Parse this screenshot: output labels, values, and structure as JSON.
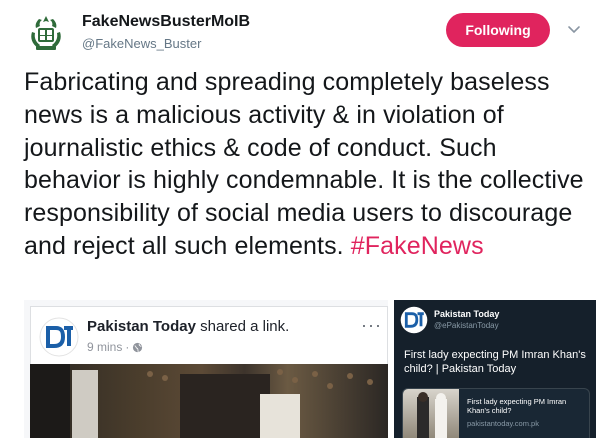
{
  "profile": {
    "name": "FakeNewsBusterMoIB",
    "handle": "@FakeNews_Buster"
  },
  "follow_button_label": "Following",
  "tweet": {
    "text": "Fabricating and spreading completely baseless news is a malicious activity & in violation of journalistic ethics & code of conduct. Such behavior is highly condemnable. It is the collective responsibility of social media users to discourage and reject all such elements. ",
    "hashtag": "#FakeNews"
  },
  "facebook_post": {
    "page_name": "Pakistan Today",
    "action": " shared a link.",
    "time": "9 mins",
    "separator": "·",
    "more": "···"
  },
  "twitter_post": {
    "name": "Pakistan Today",
    "handle": "@ePakistanToday",
    "text": "First lady expecting PM Imran Khan's child? | Pakistan Today",
    "preview_title": "First lady expecting PM Imran Khan's child?",
    "preview_domain": "pakistantoday.com.pk"
  },
  "colors": {
    "follow_bg": "#e0245e",
    "hashtag": "#e0245e",
    "twitter_dark_bg": "#15202b"
  }
}
